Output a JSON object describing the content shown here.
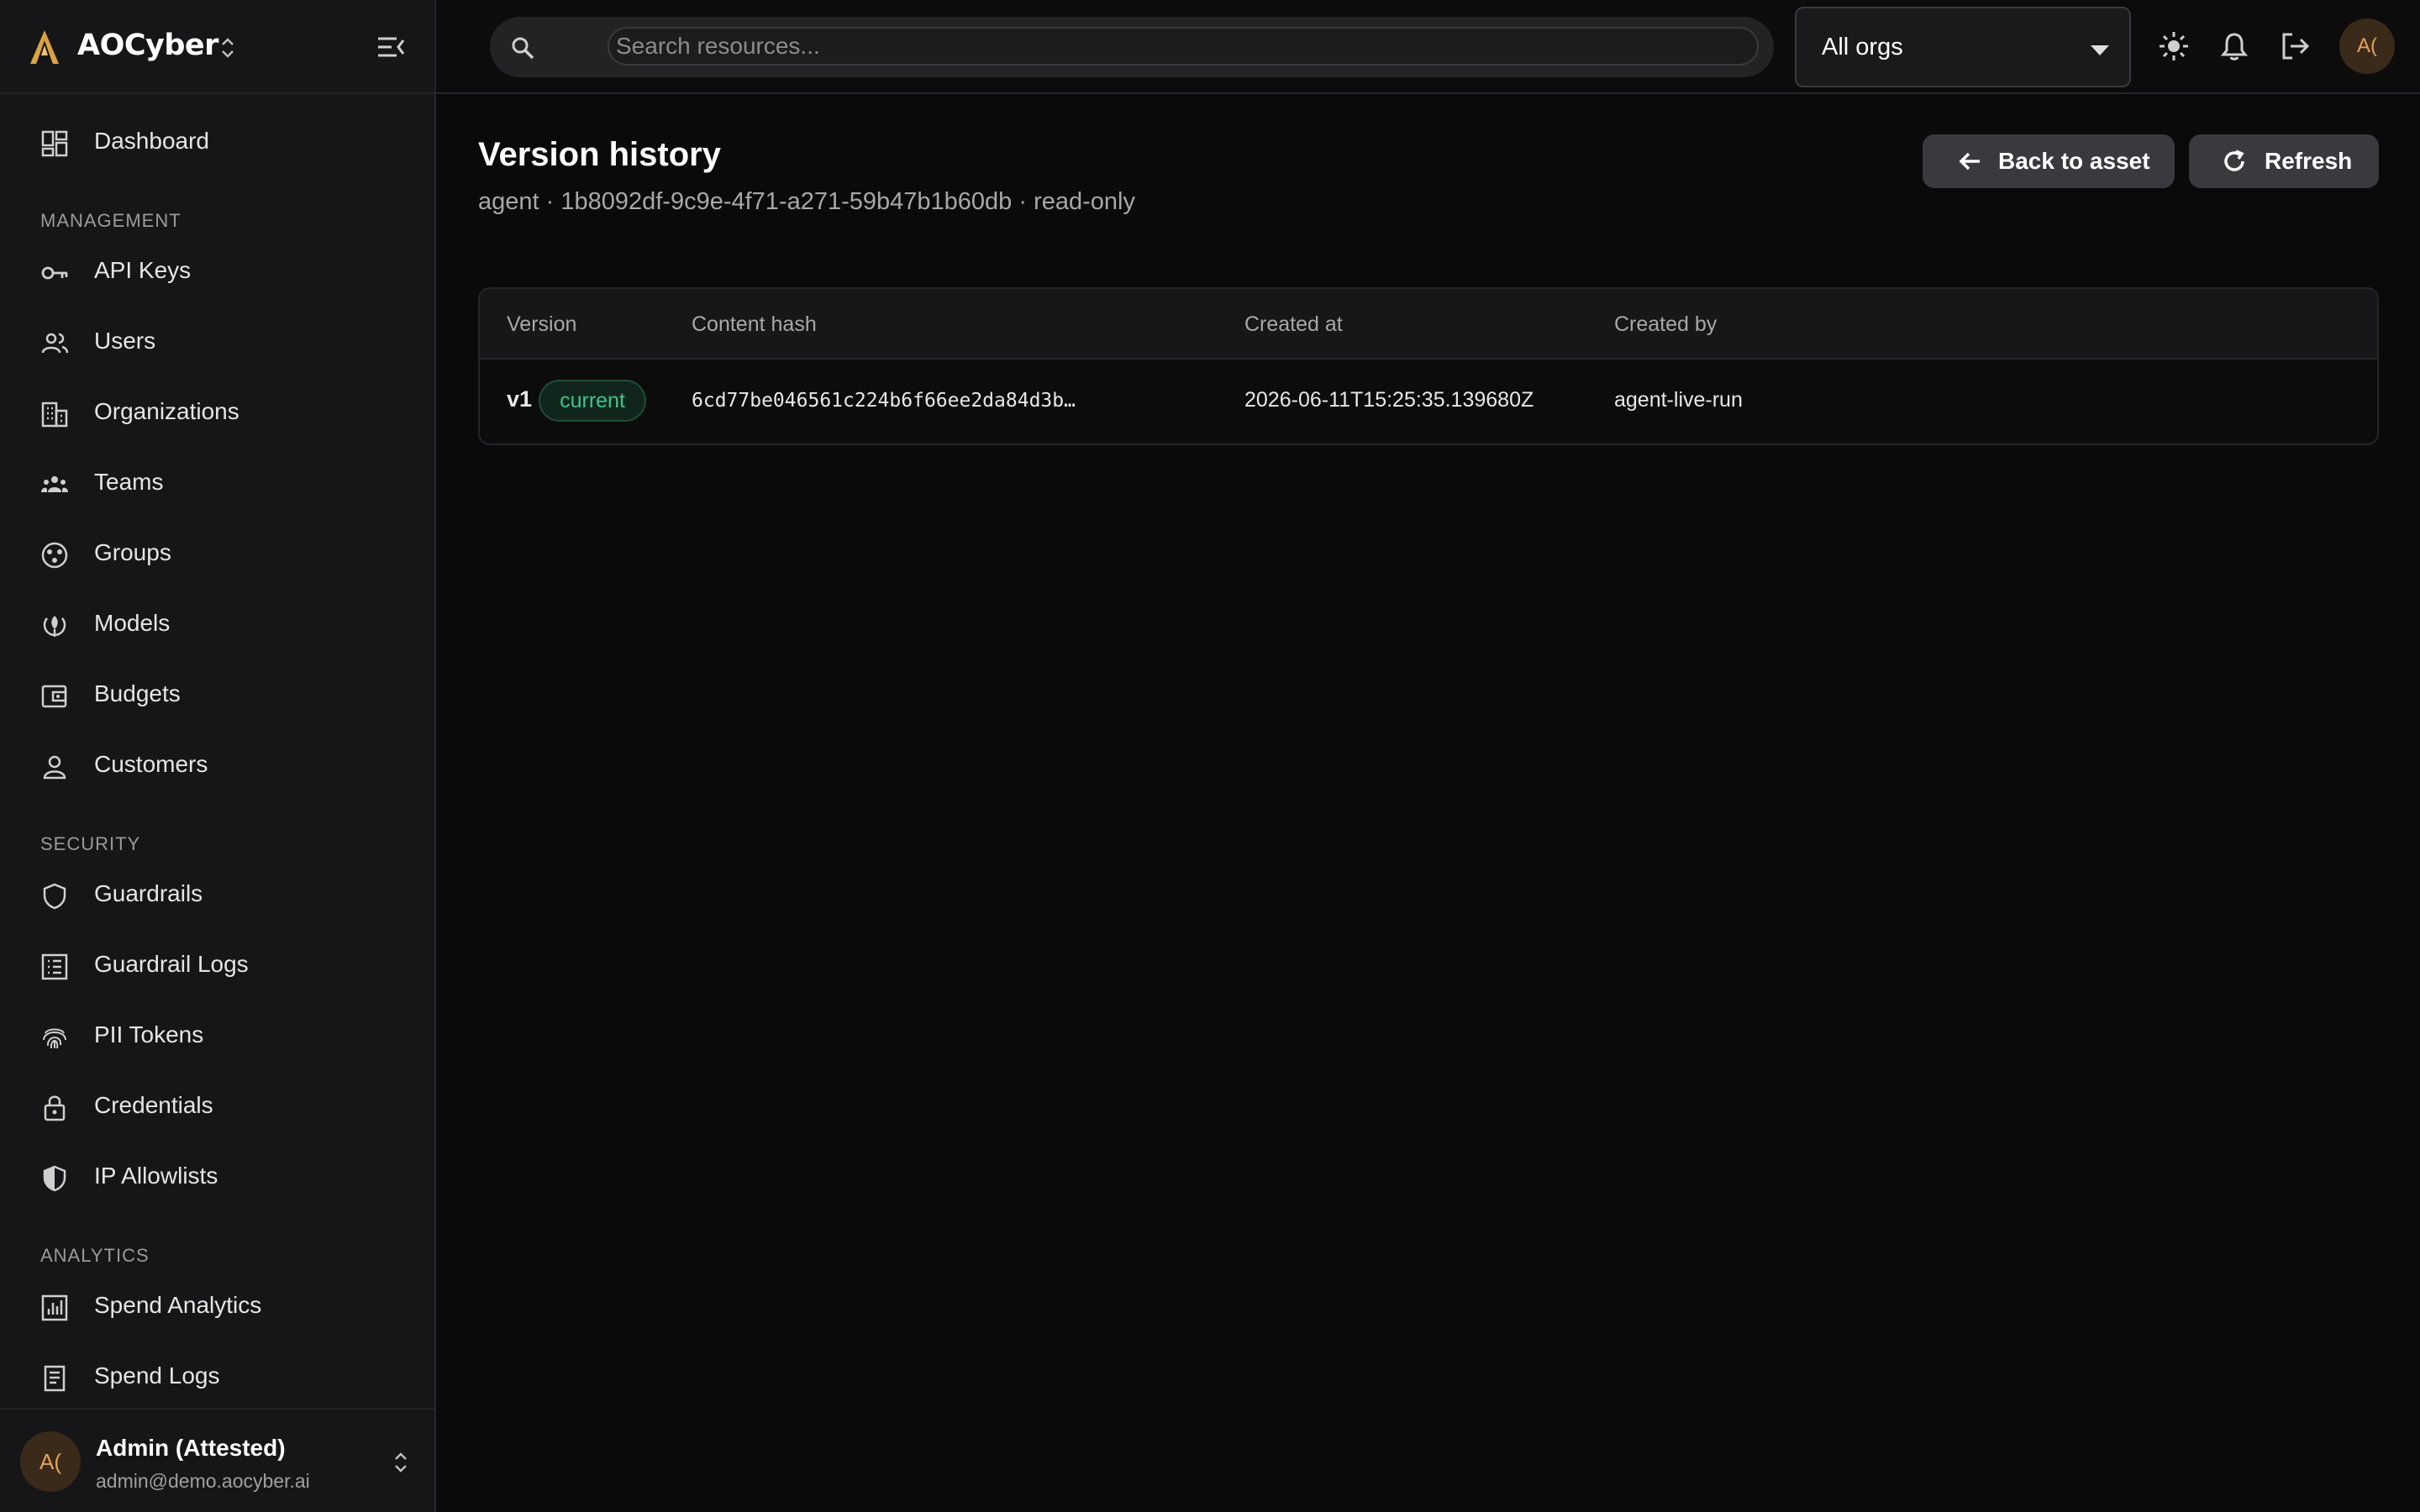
{
  "brand": {
    "name": "AOCyber"
  },
  "sidebar": {
    "top_items": [
      {
        "label": "Dashboard",
        "icon": "dashboard-icon"
      }
    ],
    "sections": [
      {
        "title": "MANAGEMENT",
        "items": [
          {
            "label": "API Keys",
            "icon": "key-icon"
          },
          {
            "label": "Users",
            "icon": "users-icon"
          },
          {
            "label": "Organizations",
            "icon": "building-icon"
          },
          {
            "label": "Teams",
            "icon": "teams-icon"
          },
          {
            "label": "Groups",
            "icon": "groups-icon"
          },
          {
            "label": "Models",
            "icon": "models-icon"
          },
          {
            "label": "Budgets",
            "icon": "wallet-icon"
          },
          {
            "label": "Customers",
            "icon": "person-icon"
          }
        ]
      },
      {
        "title": "SECURITY",
        "items": [
          {
            "label": "Guardrails",
            "icon": "shield-icon"
          },
          {
            "label": "Guardrail Logs",
            "icon": "list-icon"
          },
          {
            "label": "PII Tokens",
            "icon": "fingerprint-icon"
          },
          {
            "label": "Credentials",
            "icon": "lock-icon"
          },
          {
            "label": "IP Allowlists",
            "icon": "shield-half-icon"
          }
        ]
      },
      {
        "title": "ANALYTICS",
        "items": [
          {
            "label": "Spend Analytics",
            "icon": "chart-icon"
          },
          {
            "label": "Spend Logs",
            "icon": "receipt-icon"
          }
        ]
      }
    ]
  },
  "user": {
    "initials": "A(",
    "name": "Admin (Attested)",
    "email": "admin@demo.aocyber.ai"
  },
  "topbar": {
    "search_placeholder": "Search resources...",
    "org_selected": "All orgs",
    "avatar_initials": "A("
  },
  "page": {
    "title": "Version history",
    "subtitle": "agent · 1b8092df-9c9e-4f71-a271-59b47b1b60db · read-only",
    "back_label": "Back to asset",
    "refresh_label": "Refresh"
  },
  "table": {
    "headers": [
      "Version",
      "Content hash",
      "Created at",
      "Created by"
    ],
    "rows": [
      {
        "version": "v1",
        "badge": "current",
        "hash": "6cd77be046561c224b6f66ee2da84d3b…",
        "created_at": "2026-06-11T15:25:35.139680Z",
        "created_by": "agent-live-run"
      }
    ]
  },
  "colors": {
    "accent_green": "#3ec487",
    "avatar_text": "#e3a35b",
    "background": "#0a0a0a",
    "sidebar": "#161618"
  }
}
